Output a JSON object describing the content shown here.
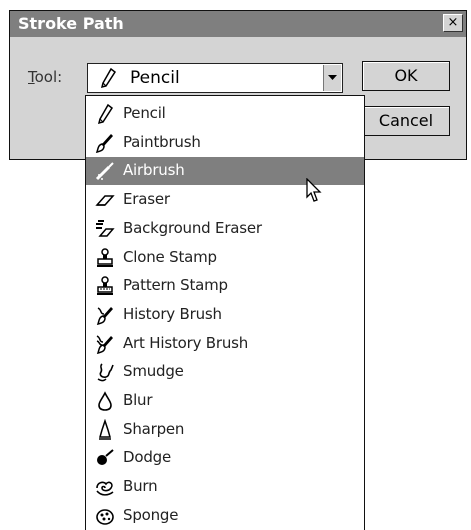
{
  "dialog": {
    "title": "Stroke Path",
    "close_label": "×",
    "tool_label_accel": "T",
    "tool_label_rest": "ool:",
    "selected_tool": "Pencil",
    "ok_label": "OK",
    "cancel_label": "Cancel"
  },
  "dropdown": {
    "highlighted_index": 2,
    "items": [
      {
        "label": "Pencil",
        "icon": "pencil-icon"
      },
      {
        "label": "Paintbrush",
        "icon": "paintbrush-icon"
      },
      {
        "label": "Airbrush",
        "icon": "airbrush-icon"
      },
      {
        "label": "Eraser",
        "icon": "eraser-icon"
      },
      {
        "label": "Background Eraser",
        "icon": "background-eraser-icon"
      },
      {
        "label": "Clone Stamp",
        "icon": "clone-stamp-icon"
      },
      {
        "label": "Pattern Stamp",
        "icon": "pattern-stamp-icon"
      },
      {
        "label": "History Brush",
        "icon": "history-brush-icon"
      },
      {
        "label": "Art History Brush",
        "icon": "art-history-brush-icon"
      },
      {
        "label": "Smudge",
        "icon": "smudge-icon"
      },
      {
        "label": "Blur",
        "icon": "blur-icon"
      },
      {
        "label": "Sharpen",
        "icon": "sharpen-icon"
      },
      {
        "label": "Dodge",
        "icon": "dodge-icon"
      },
      {
        "label": "Burn",
        "icon": "burn-icon"
      },
      {
        "label": "Sponge",
        "icon": "sponge-icon"
      }
    ]
  },
  "colors": {
    "titlebar": "#7f7f7f",
    "highlight": "#7f7f7f",
    "dialog_bg": "#d4d4d4"
  }
}
